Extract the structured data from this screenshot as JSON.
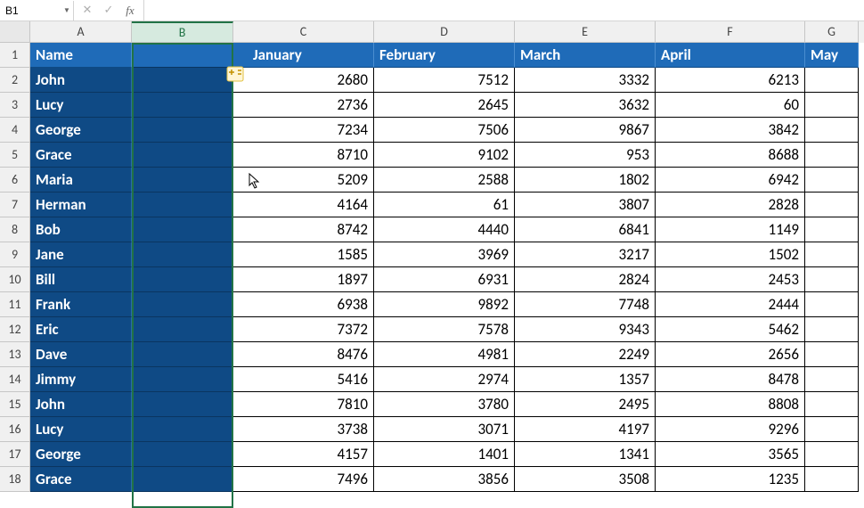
{
  "nameBox": {
    "value": "B1"
  },
  "formula": {
    "value": ""
  },
  "columns": [
    "A",
    "B",
    "C",
    "D",
    "E",
    "F",
    "G"
  ],
  "selectedColumn": "B",
  "headerRow": [
    "Name",
    "",
    "January",
    "February",
    "March",
    "April",
    "May"
  ],
  "rows": [
    {
      "n": 2,
      "name": "John",
      "v": [
        2680,
        7512,
        3332,
        6213
      ]
    },
    {
      "n": 3,
      "name": "Lucy",
      "v": [
        2736,
        2645,
        3632,
        60
      ]
    },
    {
      "n": 4,
      "name": "George",
      "v": [
        7234,
        7506,
        9867,
        3842
      ]
    },
    {
      "n": 5,
      "name": "Grace",
      "v": [
        8710,
        9102,
        953,
        8688
      ]
    },
    {
      "n": 6,
      "name": "Maria",
      "v": [
        5209,
        2588,
        1802,
        6942
      ]
    },
    {
      "n": 7,
      "name": "Herman",
      "v": [
        4164,
        61,
        3807,
        2828
      ]
    },
    {
      "n": 8,
      "name": "Bob",
      "v": [
        8742,
        4440,
        6841,
        1149
      ]
    },
    {
      "n": 9,
      "name": "Jane",
      "v": [
        1585,
        3969,
        3217,
        1502
      ]
    },
    {
      "n": 10,
      "name": "Bill",
      "v": [
        1897,
        6931,
        2824,
        2453
      ]
    },
    {
      "n": 11,
      "name": "Frank",
      "v": [
        6938,
        9892,
        7748,
        2444
      ]
    },
    {
      "n": 12,
      "name": "Eric",
      "v": [
        7372,
        7578,
        9343,
        5462
      ]
    },
    {
      "n": 13,
      "name": "Dave",
      "v": [
        8476,
        4981,
        2249,
        2656
      ]
    },
    {
      "n": 14,
      "name": "Jimmy",
      "v": [
        5416,
        2974,
        1357,
        8478
      ]
    },
    {
      "n": 15,
      "name": "John",
      "v": [
        7810,
        3780,
        2495,
        8808
      ]
    },
    {
      "n": 16,
      "name": "Lucy",
      "v": [
        3738,
        3071,
        4197,
        9296
      ]
    },
    {
      "n": 17,
      "name": "George",
      "v": [
        4157,
        1401,
        1341,
        3565
      ]
    },
    {
      "n": 18,
      "name": "Grace",
      "v": [
        7496,
        3856,
        3508,
        1235
      ]
    }
  ],
  "icons": {
    "cancel": "✕",
    "confirm": "✓",
    "fx": "fx"
  }
}
